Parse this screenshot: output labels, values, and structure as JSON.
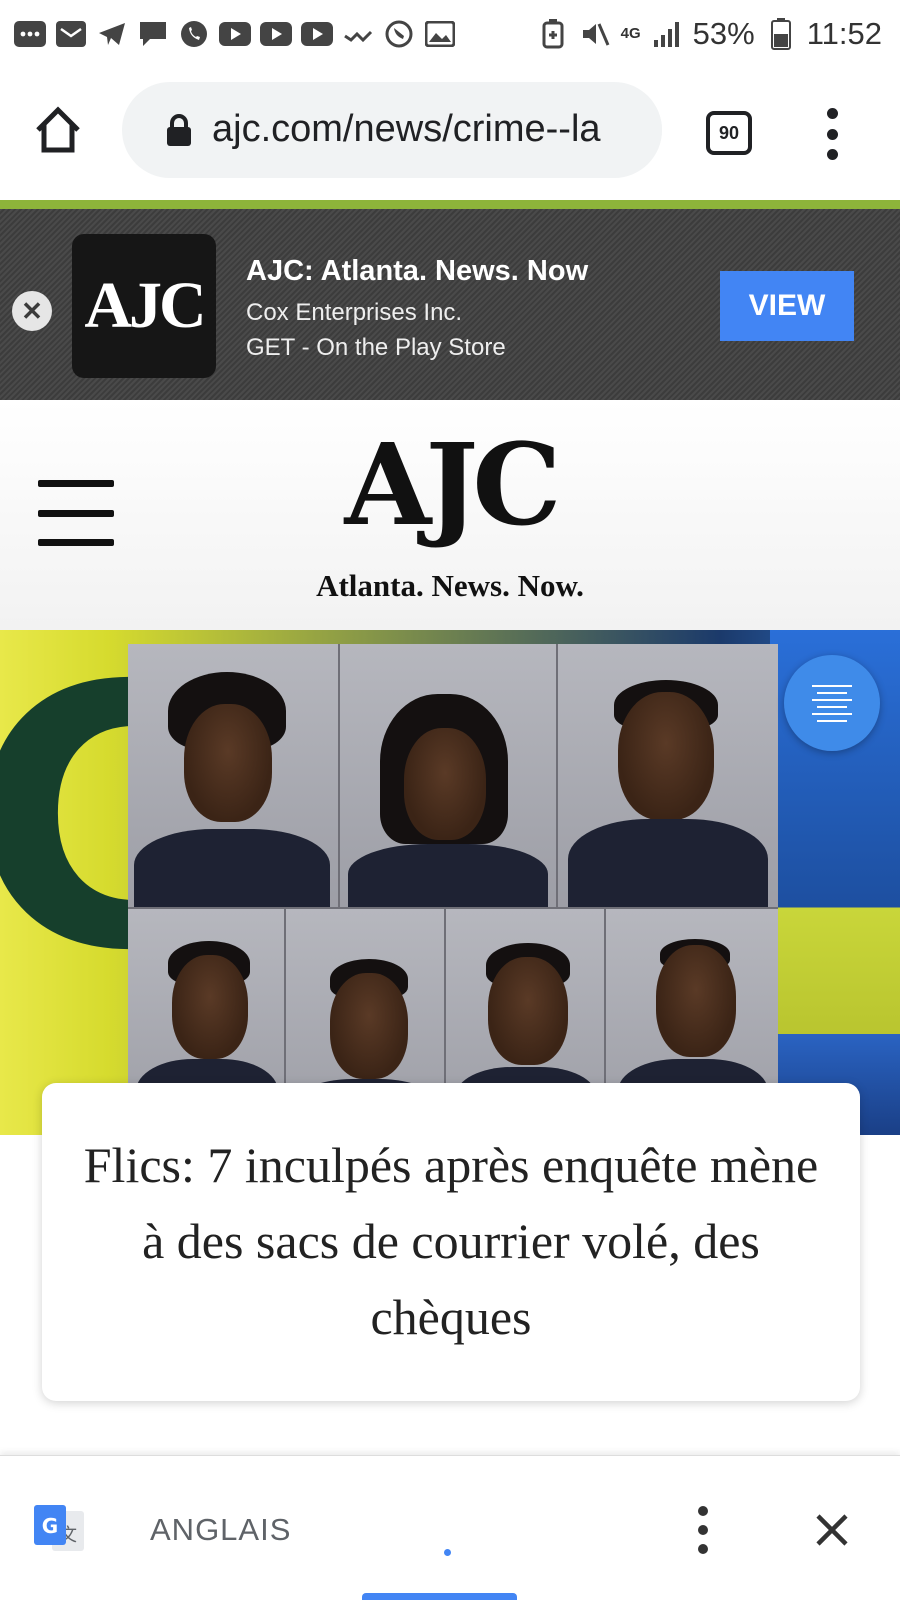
{
  "status_bar": {
    "notification_icons": [
      "more-apps-icon",
      "mail-icon",
      "telegram-icon",
      "chat-bubble-icon",
      "whatsapp-icon",
      "youtube-icon",
      "youtube-icon",
      "youtube-icon",
      "missed-call-icon",
      "viber-icon",
      "gallery-icon"
    ],
    "network_type": "4G",
    "battery_percent": "53%",
    "time": "11:52"
  },
  "browser": {
    "url": "ajc.com/news/crime--la",
    "tab_count": "90"
  },
  "app_banner": {
    "logo_text": "AJC",
    "title": "AJC: Atlanta. News. Now",
    "publisher": "Cox Enterprises Inc.",
    "store_text": "GET - On the Play Store",
    "view_button": "VIEW",
    "accent_color": "#8db43a",
    "button_color": "#4285f4"
  },
  "site_header": {
    "logo": "AJC",
    "tagline": "Atlanta. News. Now."
  },
  "article": {
    "headline": "Flics: 7 inculpés après enquête mène à des sacs de courrier volé, des chèques"
  },
  "translate_bar": {
    "language": "ANGLAIS",
    "accent_color": "#4285f4"
  }
}
